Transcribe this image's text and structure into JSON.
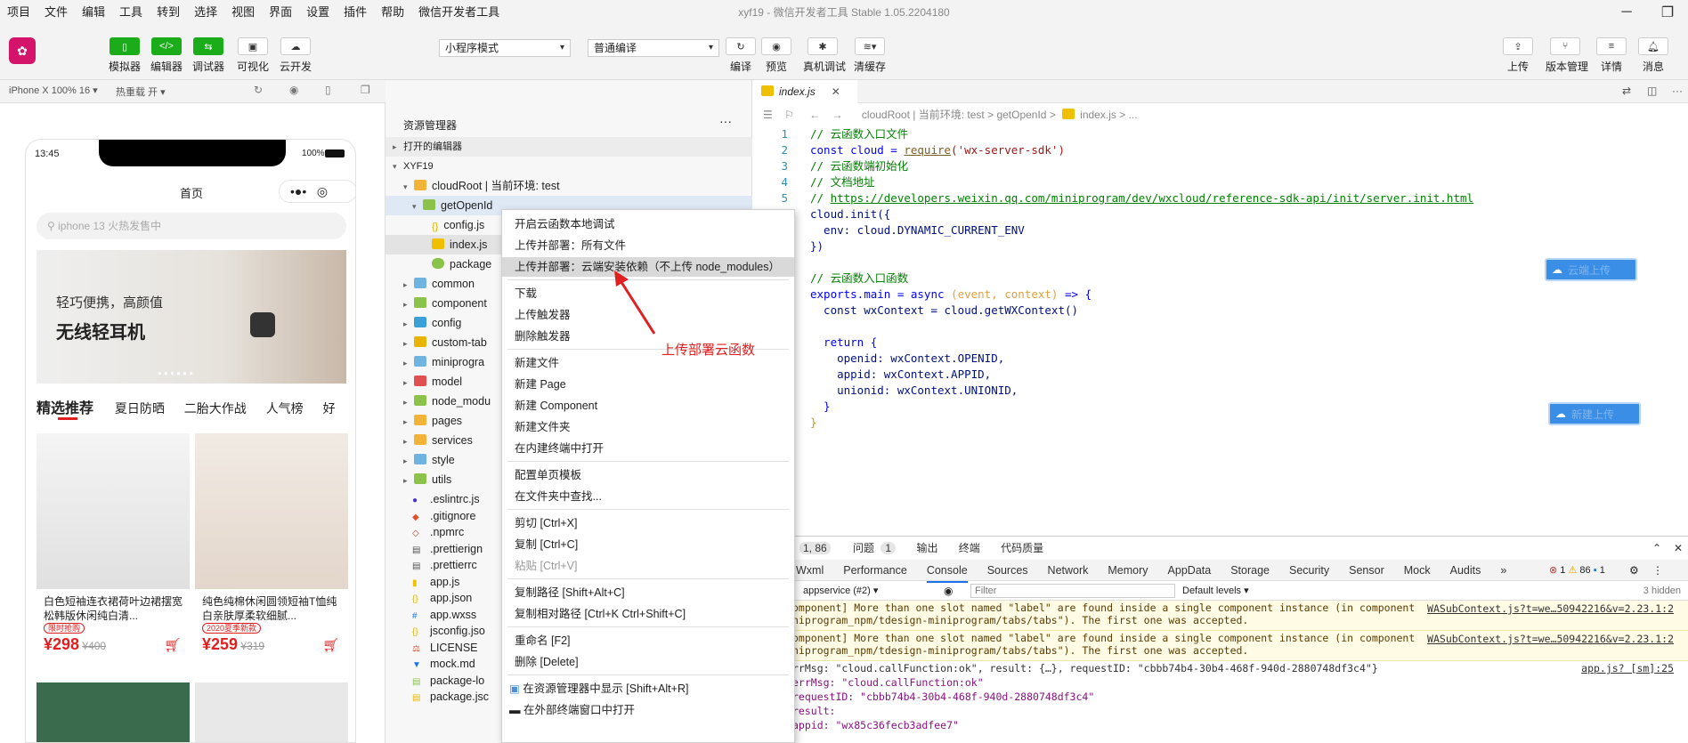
{
  "app": {
    "title": "xyf19 - 微信开发者工具 Stable 1.05.2204180",
    "menu": [
      "项目",
      "文件",
      "编辑",
      "工具",
      "转到",
      "选择",
      "视图",
      "界面",
      "设置",
      "插件",
      "帮助",
      "微信开发者工具"
    ]
  },
  "toolbar": {
    "left_buttons": [
      "模拟器",
      "编辑器",
      "调试器",
      "可视化",
      "云开发"
    ],
    "mode_select": "小程序模式",
    "compile_select": "普通编译",
    "mid_buttons": [
      "编译",
      "预览",
      "真机调试",
      "清缓存"
    ],
    "right_buttons": [
      "上传",
      "版本管理",
      "详情",
      "消息"
    ]
  },
  "subbar": {
    "device": "iPhone X 100% 16 ▾",
    "hotreload": "热重载 开 ▾"
  },
  "phone": {
    "time": "13:45",
    "battery": "100%",
    "page_title": "首页",
    "search_placeholder": "iphone 13 火热发售中",
    "banner_line1": "轻巧便携，高颜值",
    "banner_line2": "无线轻耳机",
    "tabs": [
      "精选推荐",
      "夏日防晒",
      "二胎大作战",
      "人气榜",
      "好"
    ],
    "products": [
      {
        "title": "白色短袖连衣裙荷叶边裙摆宽松韩版休闲纯白清...",
        "tag": "限时抢购",
        "price": "¥298",
        "old": "¥400"
      },
      {
        "title": "纯色纯棉休闲圆领短袖T恤纯白亲肤厚柔软细腻...",
        "tag": "2020夏季新款",
        "price": "¥259",
        "old": "¥319"
      }
    ]
  },
  "explorer": {
    "title": "资源管理器",
    "open_editors": "打开的编辑器",
    "project": "XYF19",
    "cloud_root": "cloudRoot | 当前环境: test",
    "cloud_children": [
      "getOpenId",
      "config.js",
      "index.js",
      "package"
    ],
    "folders": [
      "common",
      "component",
      "config",
      "custom-tab",
      "miniprogra",
      "model",
      "node_modu",
      "pages",
      "services",
      "style",
      "utils"
    ],
    "files": [
      ".eslintrc.js",
      ".gitignore",
      ".npmrc",
      ".prettierign",
      ".prettierrc",
      "app.js",
      "app.json",
      "app.wxss",
      "jsconfig.jso",
      "LICENSE",
      "mock.md",
      "package-lo",
      "package.jsc"
    ]
  },
  "editor": {
    "tab": "index.js",
    "breadcrumb": [
      "cloudRoot | 当前环境: test",
      "getOpenId",
      "index.js",
      "..."
    ],
    "lines": [
      "1",
      "2",
      "3",
      "4",
      "5"
    ],
    "code": {
      "l1": "// 云函数入口文件",
      "l2a": "const cloud = ",
      "l2b": "require",
      "l2c": "('wx-server-sdk')",
      "l3": "// 云函数端初始化",
      "l4": "// 文档地址",
      "l5a": "// ",
      "l5b": "https://developers.weixin.qq.com/miniprogram/dev/wxcloud/reference-sdk-api/init/server.init.html",
      "l6": "cloud.init({",
      "l7": "  env: cloud.DYNAMIC_CURRENT_ENV",
      "l8": "})",
      "l10": "// 云函数入口函数",
      "l11a": "exports.main = async ",
      "l11b": "(event, context)",
      "l11c": " => {",
      "l12": "  const wxContext = cloud.getWXContext()",
      "l14": "  return {",
      "l15": "    openid: wxContext.OPENID,",
      "l16": "    appid: wxContext.APPID,",
      "l17": "    unionid: wxContext.UNIONID,",
      "l18": "  }",
      "l19": "}"
    },
    "cloud_buttons": [
      "云端上传",
      "新建上传"
    ]
  },
  "context_menu": {
    "items": [
      "开启云函数本地调试",
      "上传并部署：所有文件",
      "上传并部署：云端安装依赖（不上传 node_modules）",
      "下载",
      "上传触发器",
      "删除触发器",
      "新建文件",
      "新建 Page",
      "新建 Component",
      "新建文件夹",
      "在内建终端中打开",
      "配置单页模板",
      "在文件夹中查找...",
      "剪切  [Ctrl+X]",
      "复制  [Ctrl+C]",
      "粘贴  [Ctrl+V]",
      "复制路径  [Shift+Alt+C]",
      "复制相对路径  [Ctrl+K Ctrl+Shift+C]",
      "重命名  [F2]",
      "删除  [Delete]",
      "在资源管理器中显示  [Shift+Alt+R]",
      "在外部终端窗口中打开"
    ]
  },
  "annotation": "上传部署云函数",
  "console": {
    "top_tabs": [
      "1, 86",
      "问题",
      "1",
      "输出",
      "终端",
      "代码质量"
    ],
    "devtools_tabs": [
      "Wxml",
      "Performance",
      "Console",
      "Sources",
      "Network",
      "Memory",
      "AppData",
      "Storage",
      "Security",
      "Sensor",
      "Mock",
      "Audits",
      "»"
    ],
    "errors": "1",
    "warnings": "86",
    "infos": "1",
    "context": "appservice (#2)",
    "filter_placeholder": "Filter",
    "levels": "Default levels ▾",
    "hidden": "3 hidden",
    "logs": [
      {
        "text": "omponent] More than one slot named \"label\" are found inside a single component instance (in component",
        "text2": "niprogram_npm/tdesign-miniprogram/tabs/tabs\"). The first one was accepted.",
        "link": "WASubContext.js?t=we…50942216&v=2.23.1:2"
      },
      {
        "text": "omponent] More than one slot named \"label\" are found inside a single component instance (in component",
        "text2": "niprogram_npm/tdesign-miniprogram/tabs/tabs\"). The first one was accepted.",
        "link": "WASubContext.js?t=we…50942216&v=2.23.1:2"
      }
    ],
    "result_line": "rrMsg: \"cloud.callFunction:ok\", result: {…}, requestID: \"cbbb74b4-30b4-468f-940d-2880748df3c4\"}",
    "result_link": "app.js? [sm]:25",
    "detail": [
      "errMsg: \"cloud.callFunction:ok\"",
      "requestID: \"cbbb74b4-30b4-468f-940d-2880748df3c4\"",
      "result:",
      "  appid: \"wx85c36fecb3adfee7\""
    ]
  },
  "colors": {
    "accent_green": "#1aad19",
    "brand": "#d4146a",
    "price_red": "#e02020"
  }
}
